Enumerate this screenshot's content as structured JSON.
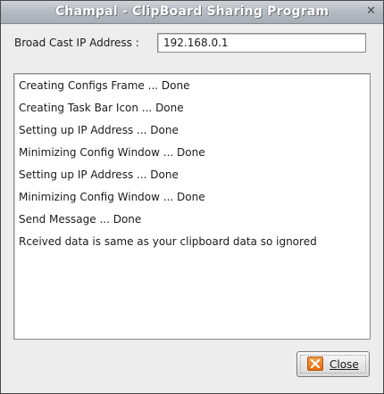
{
  "window": {
    "title": "Champal - ClipBoard Sharing Program",
    "close_glyph": "✕"
  },
  "broadcast": {
    "label": "Broad Cast IP Address :",
    "value": "192.168.0.1"
  },
  "log": {
    "lines": [
      "Creating Configs Frame ... Done",
      "Creating Task Bar Icon ... Done",
      "Setting up IP Address ... Done",
      "Minimizing Config Window ... Done",
      "Setting up IP Address ... Done",
      "Minimizing Config Window ... Done",
      "Send Message ... Done",
      "Rceived data is same as your clipboard data so ignored"
    ]
  },
  "footer": {
    "close_label_mnemonic": "C",
    "close_label_rest": "lose",
    "close_icon": "close-icon"
  },
  "colors": {
    "titlebar": "#b6bcc3",
    "window_bg": "#ededed",
    "close_icon": "#e86a12"
  }
}
